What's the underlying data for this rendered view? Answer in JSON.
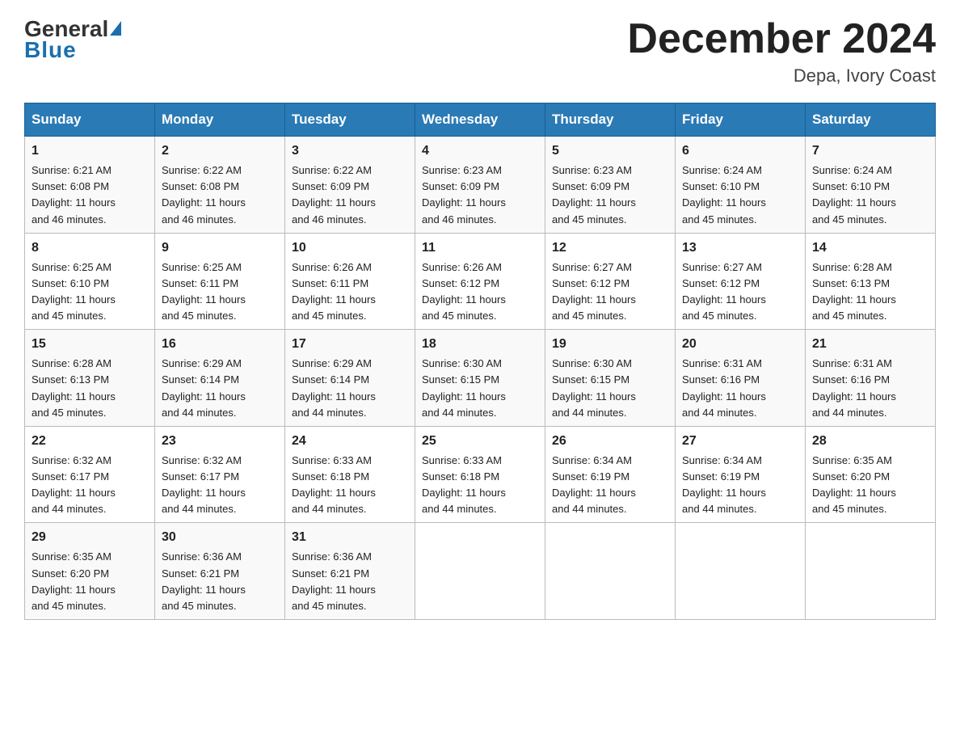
{
  "header": {
    "logo_general": "General",
    "logo_blue": "Blue",
    "month_title": "December 2024",
    "location": "Depa, Ivory Coast"
  },
  "weekdays": [
    "Sunday",
    "Monday",
    "Tuesday",
    "Wednesday",
    "Thursday",
    "Friday",
    "Saturday"
  ],
  "weeks": [
    [
      {
        "day": "1",
        "sunrise": "6:21 AM",
        "sunset": "6:08 PM",
        "daylight": "11 hours and 46 minutes."
      },
      {
        "day": "2",
        "sunrise": "6:22 AM",
        "sunset": "6:08 PM",
        "daylight": "11 hours and 46 minutes."
      },
      {
        "day": "3",
        "sunrise": "6:22 AM",
        "sunset": "6:09 PM",
        "daylight": "11 hours and 46 minutes."
      },
      {
        "day": "4",
        "sunrise": "6:23 AM",
        "sunset": "6:09 PM",
        "daylight": "11 hours and 46 minutes."
      },
      {
        "day": "5",
        "sunrise": "6:23 AM",
        "sunset": "6:09 PM",
        "daylight": "11 hours and 45 minutes."
      },
      {
        "day": "6",
        "sunrise": "6:24 AM",
        "sunset": "6:10 PM",
        "daylight": "11 hours and 45 minutes."
      },
      {
        "day": "7",
        "sunrise": "6:24 AM",
        "sunset": "6:10 PM",
        "daylight": "11 hours and 45 minutes."
      }
    ],
    [
      {
        "day": "8",
        "sunrise": "6:25 AM",
        "sunset": "6:10 PM",
        "daylight": "11 hours and 45 minutes."
      },
      {
        "day": "9",
        "sunrise": "6:25 AM",
        "sunset": "6:11 PM",
        "daylight": "11 hours and 45 minutes."
      },
      {
        "day": "10",
        "sunrise": "6:26 AM",
        "sunset": "6:11 PM",
        "daylight": "11 hours and 45 minutes."
      },
      {
        "day": "11",
        "sunrise": "6:26 AM",
        "sunset": "6:12 PM",
        "daylight": "11 hours and 45 minutes."
      },
      {
        "day": "12",
        "sunrise": "6:27 AM",
        "sunset": "6:12 PM",
        "daylight": "11 hours and 45 minutes."
      },
      {
        "day": "13",
        "sunrise": "6:27 AM",
        "sunset": "6:12 PM",
        "daylight": "11 hours and 45 minutes."
      },
      {
        "day": "14",
        "sunrise": "6:28 AM",
        "sunset": "6:13 PM",
        "daylight": "11 hours and 45 minutes."
      }
    ],
    [
      {
        "day": "15",
        "sunrise": "6:28 AM",
        "sunset": "6:13 PM",
        "daylight": "11 hours and 45 minutes."
      },
      {
        "day": "16",
        "sunrise": "6:29 AM",
        "sunset": "6:14 PM",
        "daylight": "11 hours and 44 minutes."
      },
      {
        "day": "17",
        "sunrise": "6:29 AM",
        "sunset": "6:14 PM",
        "daylight": "11 hours and 44 minutes."
      },
      {
        "day": "18",
        "sunrise": "6:30 AM",
        "sunset": "6:15 PM",
        "daylight": "11 hours and 44 minutes."
      },
      {
        "day": "19",
        "sunrise": "6:30 AM",
        "sunset": "6:15 PM",
        "daylight": "11 hours and 44 minutes."
      },
      {
        "day": "20",
        "sunrise": "6:31 AM",
        "sunset": "6:16 PM",
        "daylight": "11 hours and 44 minutes."
      },
      {
        "day": "21",
        "sunrise": "6:31 AM",
        "sunset": "6:16 PM",
        "daylight": "11 hours and 44 minutes."
      }
    ],
    [
      {
        "day": "22",
        "sunrise": "6:32 AM",
        "sunset": "6:17 PM",
        "daylight": "11 hours and 44 minutes."
      },
      {
        "day": "23",
        "sunrise": "6:32 AM",
        "sunset": "6:17 PM",
        "daylight": "11 hours and 44 minutes."
      },
      {
        "day": "24",
        "sunrise": "6:33 AM",
        "sunset": "6:18 PM",
        "daylight": "11 hours and 44 minutes."
      },
      {
        "day": "25",
        "sunrise": "6:33 AM",
        "sunset": "6:18 PM",
        "daylight": "11 hours and 44 minutes."
      },
      {
        "day": "26",
        "sunrise": "6:34 AM",
        "sunset": "6:19 PM",
        "daylight": "11 hours and 44 minutes."
      },
      {
        "day": "27",
        "sunrise": "6:34 AM",
        "sunset": "6:19 PM",
        "daylight": "11 hours and 44 minutes."
      },
      {
        "day": "28",
        "sunrise": "6:35 AM",
        "sunset": "6:20 PM",
        "daylight": "11 hours and 45 minutes."
      }
    ],
    [
      {
        "day": "29",
        "sunrise": "6:35 AM",
        "sunset": "6:20 PM",
        "daylight": "11 hours and 45 minutes."
      },
      {
        "day": "30",
        "sunrise": "6:36 AM",
        "sunset": "6:21 PM",
        "daylight": "11 hours and 45 minutes."
      },
      {
        "day": "31",
        "sunrise": "6:36 AM",
        "sunset": "6:21 PM",
        "daylight": "11 hours and 45 minutes."
      },
      null,
      null,
      null,
      null
    ]
  ],
  "labels": {
    "sunrise": "Sunrise:",
    "sunset": "Sunset:",
    "daylight": "Daylight:"
  }
}
